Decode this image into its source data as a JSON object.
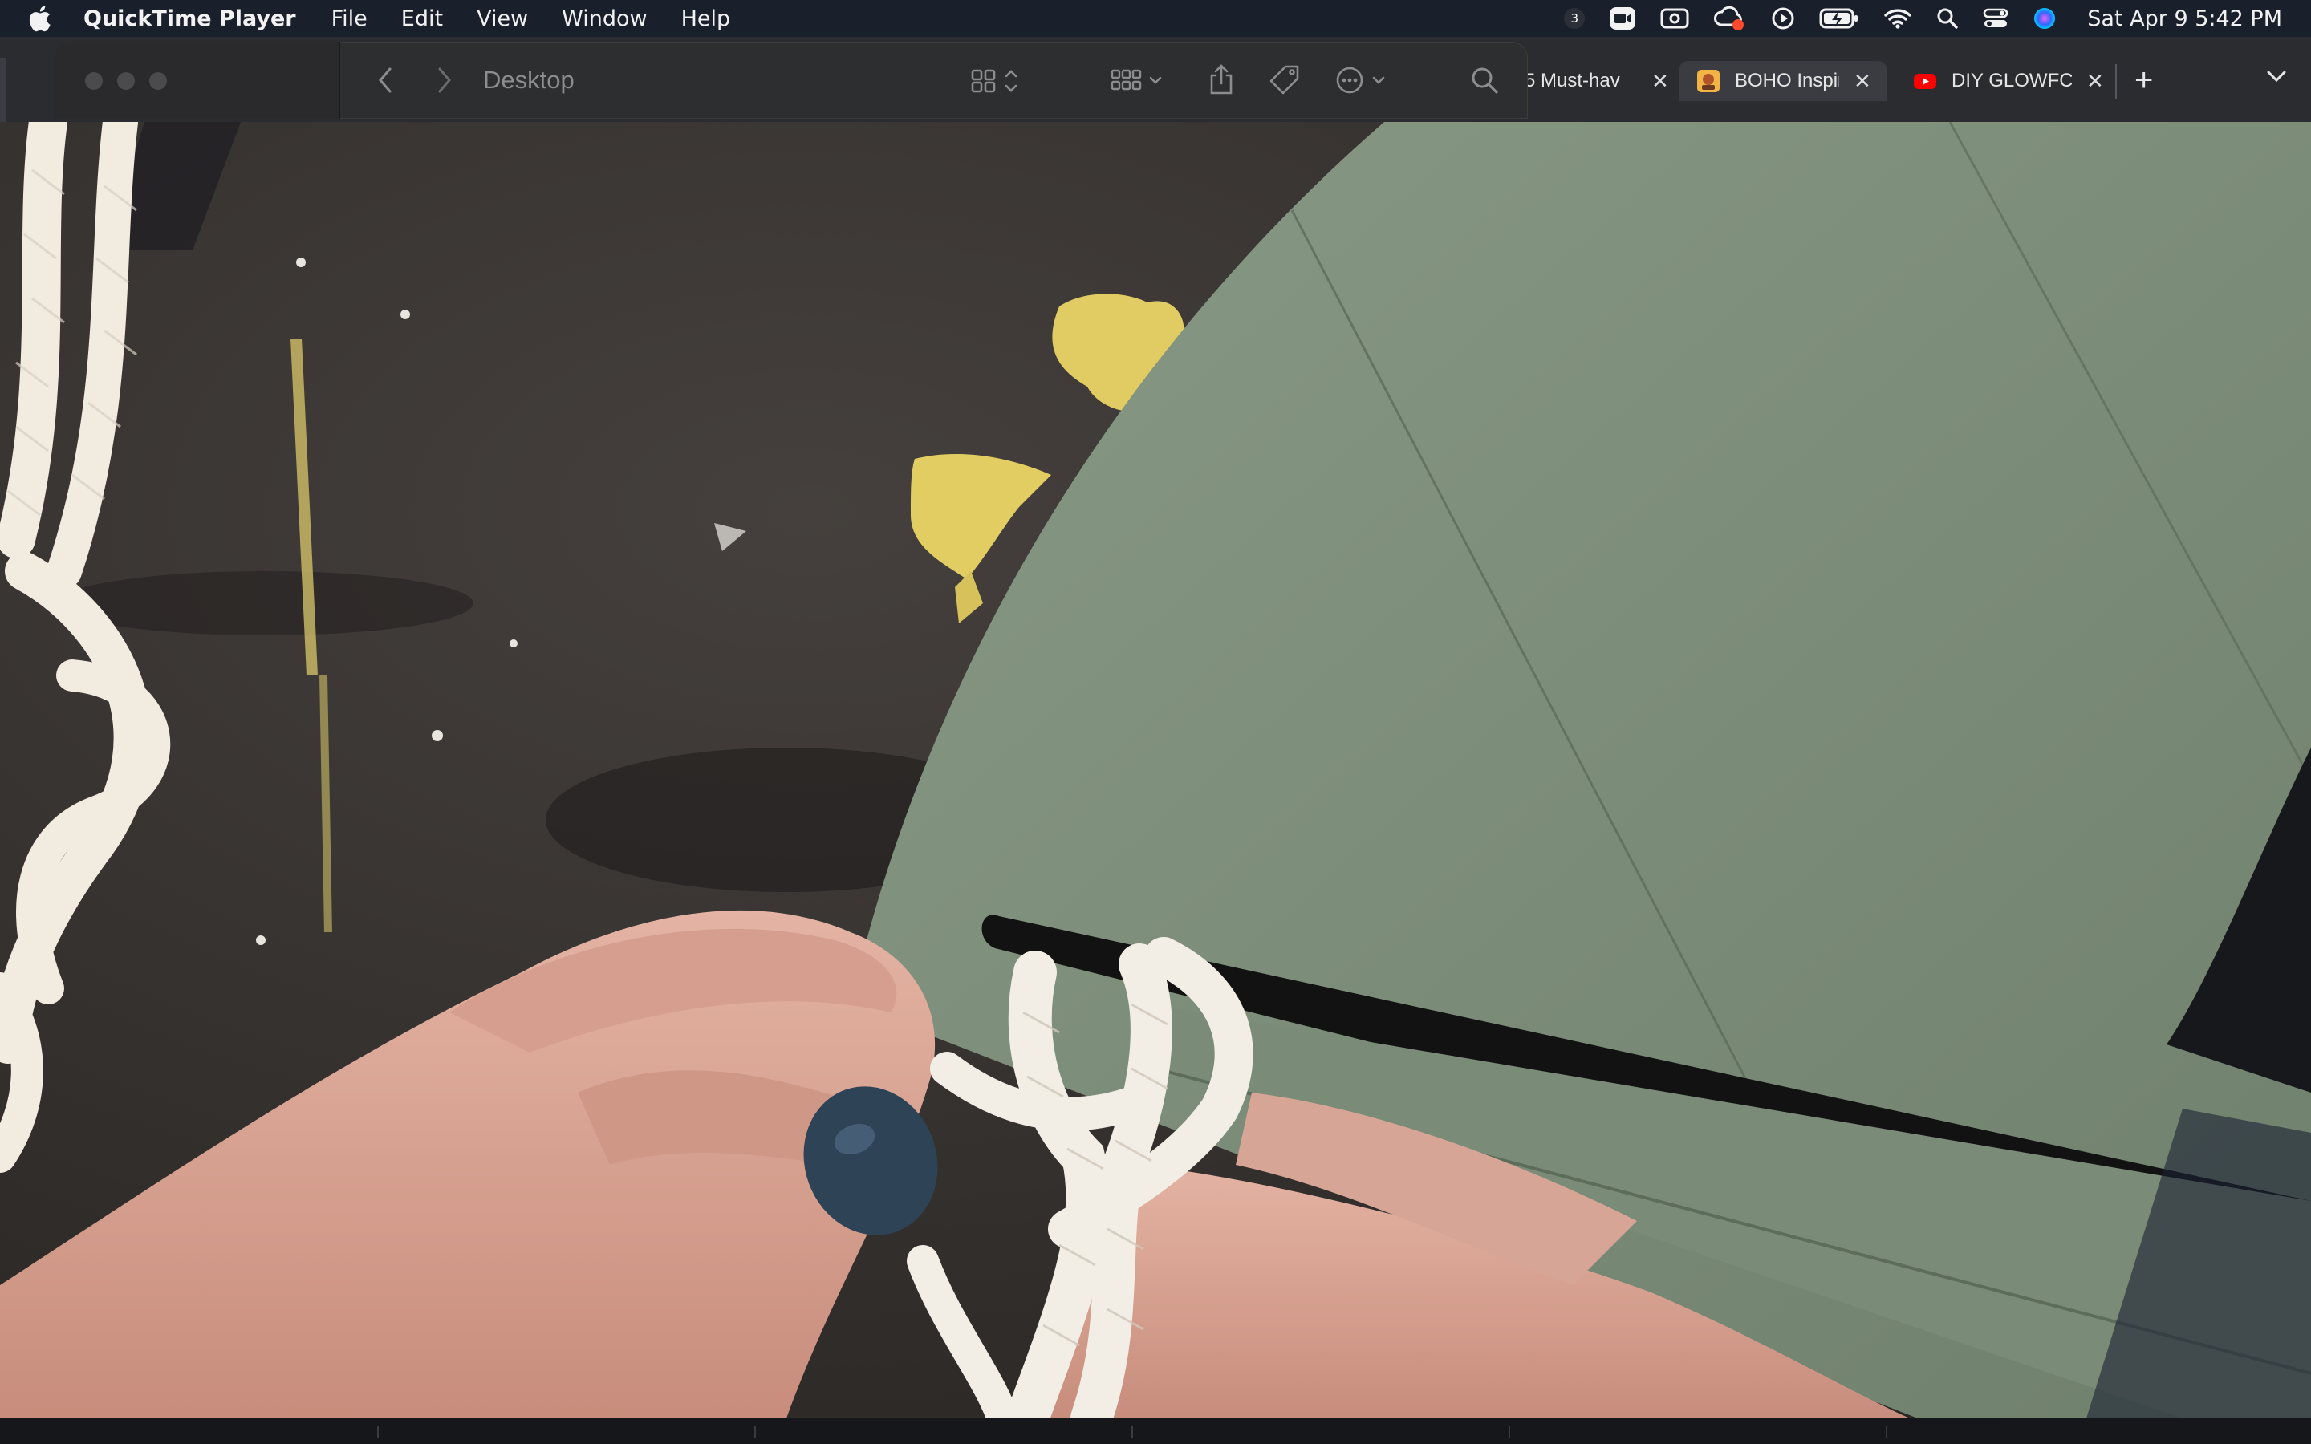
{
  "menubar": {
    "app_name": "QuickTime Player",
    "items": [
      "File",
      "Edit",
      "View",
      "Window",
      "Help"
    ],
    "status_badge": "3",
    "clock": "Sat Apr 9  5:42 PM",
    "icons": [
      "apple-logo",
      "zoom-icon",
      "screen-record-icon",
      "creative-cloud-icon",
      "play-icon",
      "battery-charging-icon",
      "wifi-icon",
      "spotlight-search-icon",
      "control-center-icon",
      "siri-icon"
    ]
  },
  "finder": {
    "title": "Desktop",
    "icons": [
      "back-icon",
      "forward-icon",
      "view-grid-icon",
      "group-icon",
      "share-icon",
      "tag-icon",
      "more-actions-icon",
      "search-icon"
    ]
  },
  "browser": {
    "tabs": [
      {
        "title": "5 Must-hav"
      },
      {
        "title": "BOHO Inspir"
      },
      {
        "title": "DIY GLOWFC"
      }
    ],
    "close_label": "✕",
    "new_tab_label": "+"
  },
  "colors": {
    "menubar_bg": "#1a1f2c",
    "board_green": "#7c8c79",
    "table_dark": "#3a3633",
    "paint_yellow": "#e0cc63",
    "rope": "#f1ebe0",
    "youtube_red": "#ff0000"
  }
}
